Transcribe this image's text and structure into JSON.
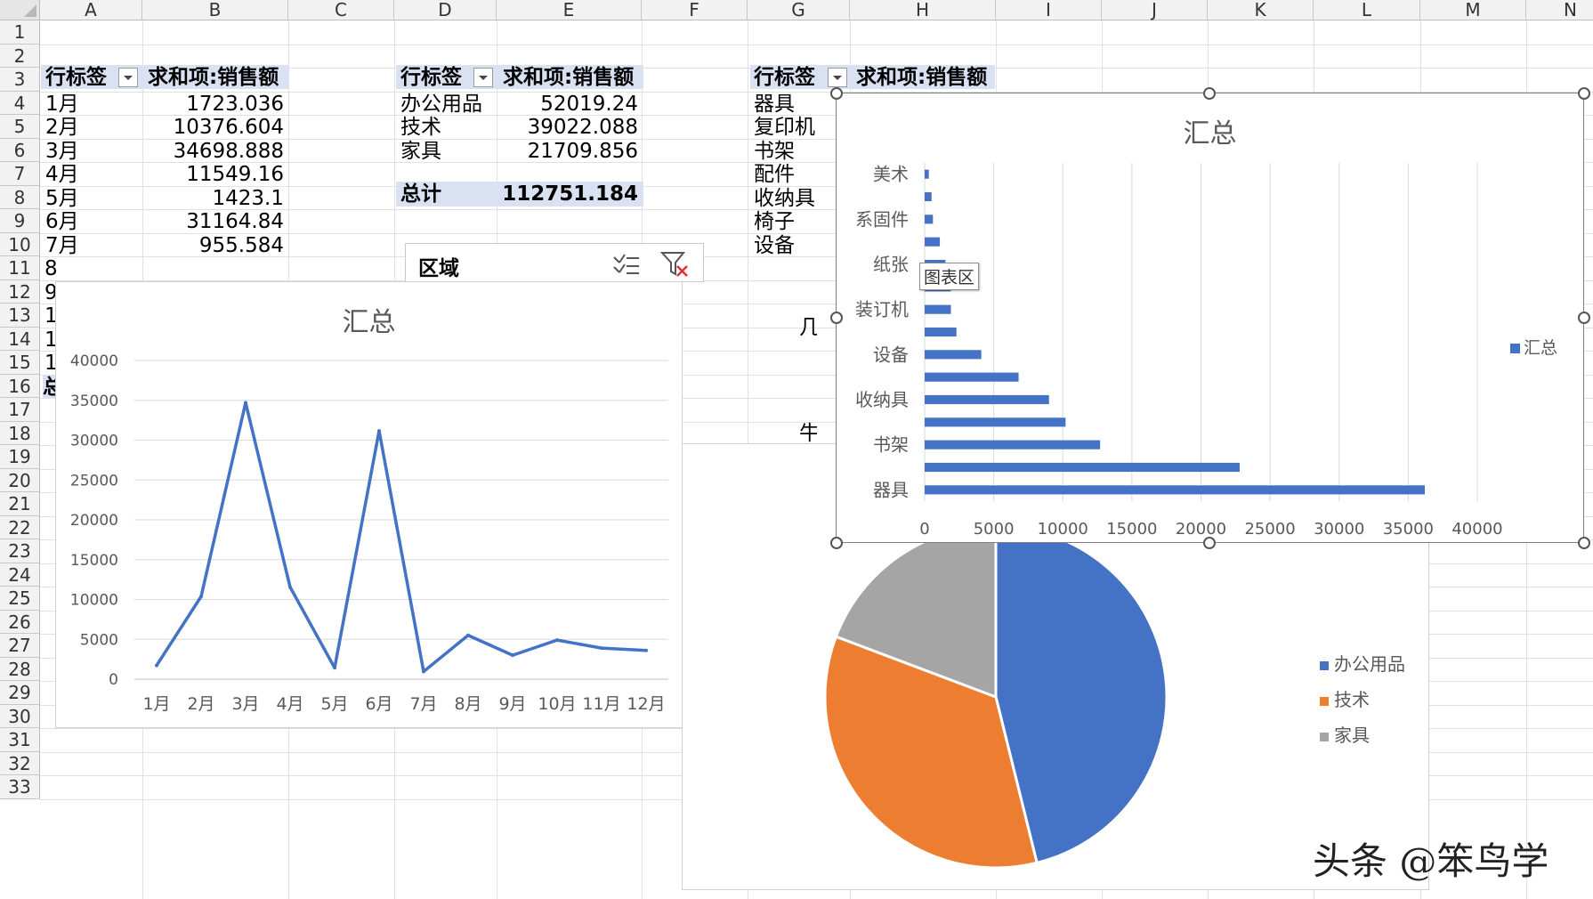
{
  "columns": [
    "A",
    "B",
    "C",
    "D",
    "E",
    "F",
    "G",
    "H",
    "I",
    "J",
    "K",
    "L",
    "M",
    "N"
  ],
  "rows": [
    "1",
    "2",
    "3",
    "4",
    "5",
    "6",
    "7",
    "8",
    "9",
    "10",
    "11",
    "12",
    "13",
    "14",
    "15",
    "16",
    "17",
    "18",
    "19",
    "20",
    "21",
    "22",
    "23",
    "24",
    "25",
    "26",
    "27",
    "28",
    "29",
    "30",
    "31",
    "32",
    "33"
  ],
  "pivot_month": {
    "header_label": "行标签",
    "header_value": "求和项:销售额",
    "rows": [
      {
        "label": "1月",
        "value": "1723.036"
      },
      {
        "label": "2月",
        "value": "10376.604"
      },
      {
        "label": "3月",
        "value": "34698.888"
      },
      {
        "label": "4月",
        "value": "11549.16"
      },
      {
        "label": "5月",
        "value": "1423.1"
      },
      {
        "label": "6月",
        "value": "31164.84"
      },
      {
        "label": "7月",
        "value": "955.584"
      }
    ],
    "partial_rows": [
      "8",
      "9",
      "1",
      "1",
      "1"
    ],
    "partial_total": "总"
  },
  "pivot_category": {
    "header_label": "行标签",
    "header_value": "求和项:销售额",
    "rows": [
      {
        "label": "办公用品",
        "value": "52019.24"
      },
      {
        "label": "技术",
        "value": "39022.088"
      },
      {
        "label": "家具",
        "value": "21709.856"
      }
    ],
    "total_label": "总计",
    "total_value": "112751.184"
  },
  "pivot_sub": {
    "header_label": "行标签",
    "header_value": "求和项:销售额",
    "rows": [
      "器具",
      "复印机",
      "书架",
      "配件",
      "收纳具",
      "椅子",
      "设备"
    ],
    "partial_1": "几",
    "partial_2": "牛"
  },
  "slicer": {
    "title": "区域"
  },
  "tooltip": "图表区",
  "watermark": "头条 @笨鸟学",
  "colors": {
    "blue": "#4472c4",
    "orange": "#ed7d31",
    "gray": "#a5a5a5"
  },
  "line_chart": {
    "title": "汇总",
    "chart_data": {
      "type": "line",
      "title": "汇总",
      "categories": [
        "1月",
        "2月",
        "3月",
        "4月",
        "5月",
        "6月",
        "7月",
        "8月",
        "9月",
        "10月",
        "11月",
        "12月"
      ],
      "values": [
        1723,
        10377,
        34699,
        11549,
        1423,
        31165,
        956,
        5500,
        3000,
        4900,
        3900,
        3600
      ],
      "yticks": [
        "0",
        "5000",
        "10000",
        "15000",
        "20000",
        "25000",
        "30000",
        "35000",
        "40000"
      ],
      "ylim": [
        0,
        40000
      ]
    }
  },
  "bar_chart": {
    "title": "汇总",
    "legend": "汇总",
    "chart_data": {
      "type": "bar",
      "title": "汇总",
      "orientation": "horizontal",
      "categories": [
        "器具",
        "",
        "书架",
        "",
        "收纳具",
        "",
        "设备",
        "",
        "装订机",
        "",
        "纸张",
        "",
        "系固件",
        "",
        "美术"
      ],
      "values": [
        36200,
        22800,
        12700,
        10200,
        9000,
        6800,
        4100,
        2300,
        1900,
        1900,
        1500,
        1100,
        600,
        500,
        300
      ],
      "category_labels": [
        "器具",
        "书架",
        "收纳具",
        "设备",
        "装订机",
        "纸张",
        "系固件",
        "美术"
      ],
      "xticks": [
        "0",
        "5000",
        "10000",
        "15000",
        "20000",
        "25000",
        "30000",
        "35000",
        "40000"
      ],
      "xlim": [
        0,
        40000
      ]
    }
  },
  "pie_chart": {
    "legend": [
      "办公用品",
      "技术",
      "家具"
    ],
    "chart_data": {
      "type": "pie",
      "labels": [
        "办公用品",
        "技术",
        "家具"
      ],
      "values": [
        52019.24,
        39022.088,
        21709.856
      ]
    }
  }
}
